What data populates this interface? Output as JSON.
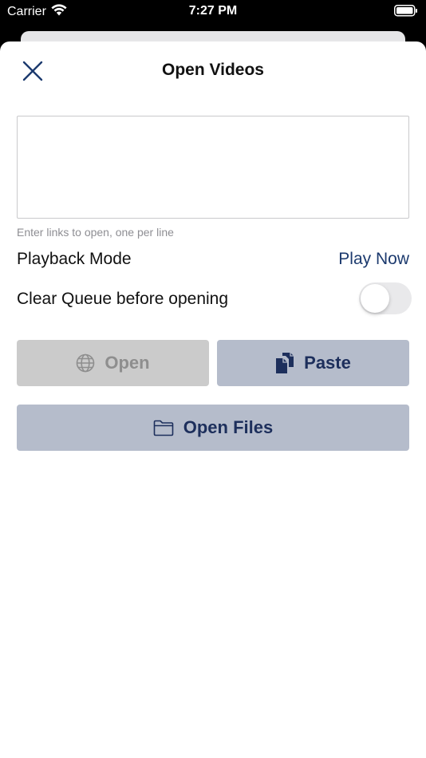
{
  "status_bar": {
    "carrier": "Carrier",
    "time": "7:27 PM",
    "icons": [
      "wifi-icon",
      "battery-icon"
    ]
  },
  "sheet": {
    "title": "Open Videos",
    "close_icon": "close-icon"
  },
  "links_input": {
    "value": "",
    "hint": "Enter links to open, one per line"
  },
  "playback_mode": {
    "label": "Playback Mode",
    "value": "Play Now"
  },
  "clear_queue": {
    "label": "Clear Queue before opening",
    "enabled": false
  },
  "buttons": {
    "open": {
      "label": "Open",
      "icon": "globe-icon",
      "disabled": true
    },
    "paste": {
      "label": "Paste",
      "icon": "clipboard-icon"
    },
    "open_files": {
      "label": "Open Files",
      "icon": "folder-icon"
    }
  },
  "colors": {
    "accent": "#1c3a6e",
    "button_bg": "#b5bccb",
    "button_text": "#1d2f5c",
    "disabled_bg": "#cbcbcb",
    "disabled_text": "#8e8e8e"
  }
}
